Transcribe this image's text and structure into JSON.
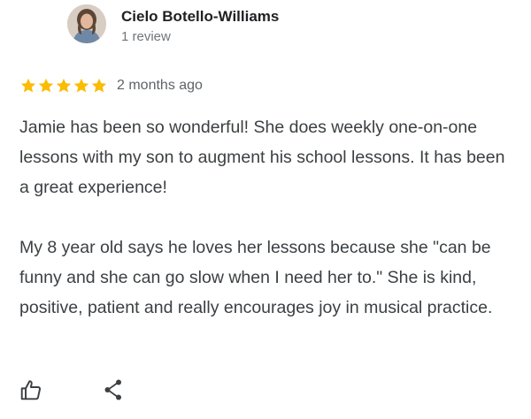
{
  "reviewer": {
    "name": "Cielo Botello-Williams",
    "review_count": "1 review",
    "avatar_icon": "reviewer-photo"
  },
  "rating": {
    "stars": 5,
    "max_stars": 5,
    "star_color": "#fbbc04",
    "age": "2 months ago"
  },
  "review": {
    "paragraphs": [
      "Jamie has been so wonderful! She does weekly one-on-one lessons with my son to augment his school lessons. It has been a great experience!",
      "My 8 year old says he loves her lessons because she \"can be funny and she can go slow when I need her to.\" She is kind, positive, patient and really encourages joy in musical practice."
    ]
  },
  "actions": {
    "like_icon": "thumbs-up-icon",
    "share_icon": "share-icon"
  }
}
